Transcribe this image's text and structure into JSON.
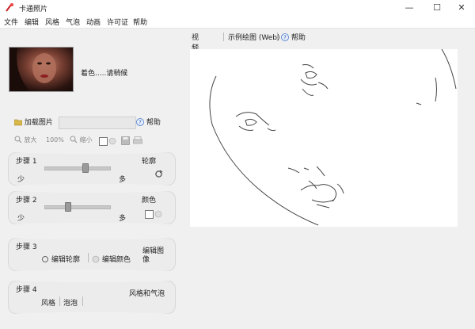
{
  "window": {
    "title": "卡通照片",
    "minimize": "—",
    "maximize": "☐",
    "close": "✕"
  },
  "menu": [
    "文件",
    "编辑",
    "风格",
    "气泡",
    "动画",
    "许可证",
    "帮助"
  ],
  "left": {
    "status": "着色.....请稍候",
    "load_button": "加载图片",
    "help_button": "帮助",
    "zoom_in": "放大",
    "zoom_value": "100%",
    "zoom_out": "缩小",
    "steps": [
      {
        "title": "步骤 1",
        "right": "轮廓",
        "min": "少",
        "max": "多",
        "slider_value": 0.62
      },
      {
        "title": "步骤 2",
        "right": "颜色",
        "min": "少",
        "max": "多",
        "slider_value": 0.35
      },
      {
        "title": "步骤 3",
        "right": "编辑图像",
        "tool1": "编辑轮廓",
        "tool2": "编辑颜色"
      },
      {
        "title": "步骤 4",
        "right": "风格和气泡",
        "tool1": "风格",
        "tool2": "泡泡"
      }
    ]
  },
  "tabs": [
    "视频教程",
    "示例绘图 (Web)",
    "帮助"
  ]
}
